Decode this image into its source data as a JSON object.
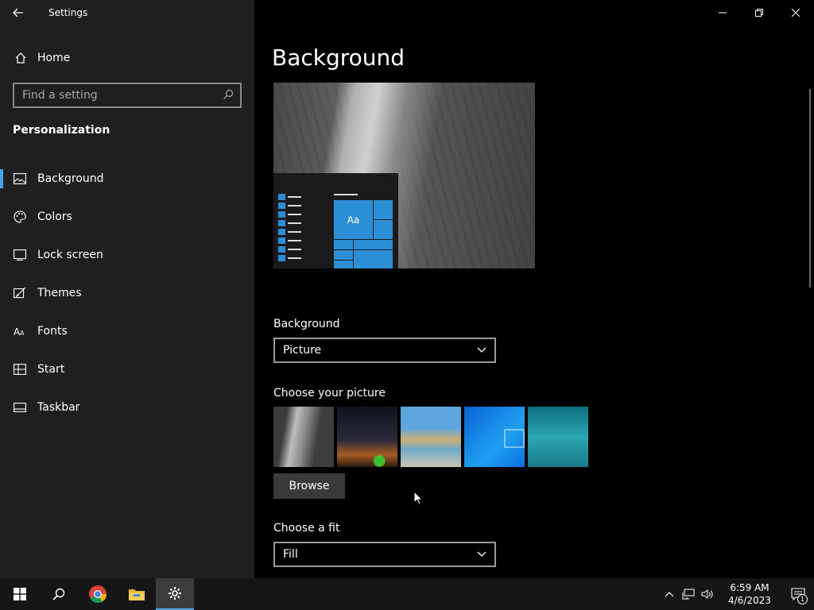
{
  "app": {
    "title": "Settings"
  },
  "sidebar": {
    "home_label": "Home",
    "search_placeholder": "Find a setting",
    "section_title": "Personalization",
    "items": [
      {
        "label": "Background",
        "icon": "picture-icon",
        "active": true
      },
      {
        "label": "Colors",
        "icon": "palette-icon",
        "active": false
      },
      {
        "label": "Lock screen",
        "icon": "lock-screen-icon",
        "active": false
      },
      {
        "label": "Themes",
        "icon": "themes-icon",
        "active": false
      },
      {
        "label": "Fonts",
        "icon": "fonts-icon",
        "active": false
      },
      {
        "label": "Start",
        "icon": "start-icon",
        "active": false
      },
      {
        "label": "Taskbar",
        "icon": "taskbar-icon",
        "active": false
      }
    ]
  },
  "main": {
    "title": "Background",
    "preview_tile_text": "Aa",
    "background_label": "Background",
    "background_value": "Picture",
    "choose_picture_label": "Choose your picture",
    "browse_label": "Browse",
    "fit_label": "Choose a fit",
    "fit_value": "Fill"
  },
  "taskbar": {
    "time": "6:59 AM",
    "date": "4/6/2023",
    "notification_count": "1"
  },
  "colors": {
    "accent": "#2b8fd6",
    "sidebar_bg": "#1f1f1f",
    "main_bg": "#000000"
  }
}
